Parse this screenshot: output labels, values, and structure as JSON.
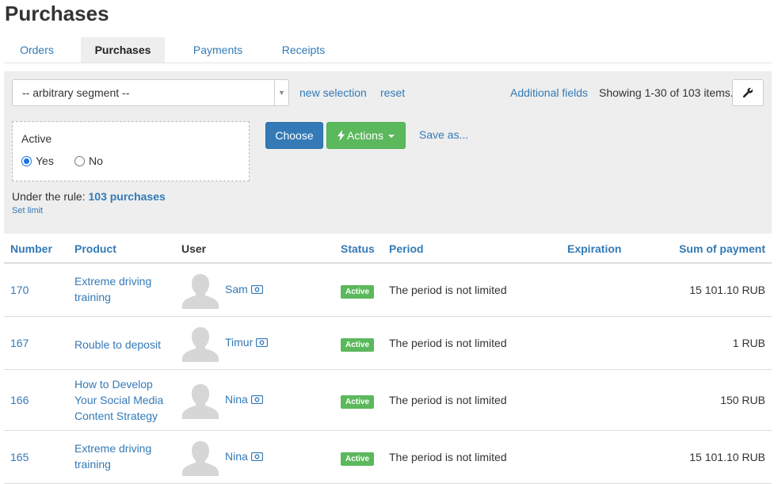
{
  "page": {
    "title": "Purchases"
  },
  "tabs": [
    {
      "label": "Orders",
      "active": false
    },
    {
      "label": "Purchases",
      "active": true
    },
    {
      "label": "Payments",
      "active": false
    },
    {
      "label": "Receipts",
      "active": false
    }
  ],
  "filter": {
    "segment_value": "-- arbitrary segment --",
    "new_selection": "new selection",
    "reset": "reset",
    "additional_fields": "Additional fields",
    "showing": "Showing 1-30 of 103 items.",
    "rule": {
      "label": "Active",
      "options": [
        {
          "label": "Yes",
          "checked": true
        },
        {
          "label": "No",
          "checked": false
        }
      ]
    },
    "choose": "Choose",
    "actions": "Actions",
    "save_as": "Save as...",
    "under_rule_prefix": "Under the rule:",
    "under_rule_count": "103 purchases",
    "set_limit": "Set limit"
  },
  "table": {
    "headers": {
      "number": "Number",
      "product": "Product",
      "user": "User",
      "status": "Status",
      "period": "Period",
      "expiration": "Expiration",
      "sum": "Sum of payment"
    },
    "rows": [
      {
        "number": "170",
        "product": "Extreme driving training",
        "user": "Sam",
        "status": "Active",
        "period": "The period is not limited",
        "sum": "15 101.10 RUB"
      },
      {
        "number": "167",
        "product": "Rouble to deposit",
        "user": "Timur",
        "status": "Active",
        "period": "The period is not limited",
        "sum": "1 RUB"
      },
      {
        "number": "166",
        "product": "How to Develop Your Social Media Content Strategy",
        "user": "Nina",
        "status": "Active",
        "period": "The period is not limited",
        "sum": "150 RUB"
      },
      {
        "number": "165",
        "product": "Extreme driving training",
        "user": "Nina",
        "status": "Active",
        "period": "The period is not limited",
        "sum": "15 101.10 RUB"
      }
    ]
  },
  "colors": {
    "link": "#337ab7",
    "primary": "#337ab7",
    "success": "#5cb85c",
    "panel": "#eeeeee"
  },
  "icons": {
    "wrench": "wrench-icon",
    "bolt": "bolt-icon",
    "user_card": "id-card-icon",
    "avatar": "user-avatar-icon"
  }
}
